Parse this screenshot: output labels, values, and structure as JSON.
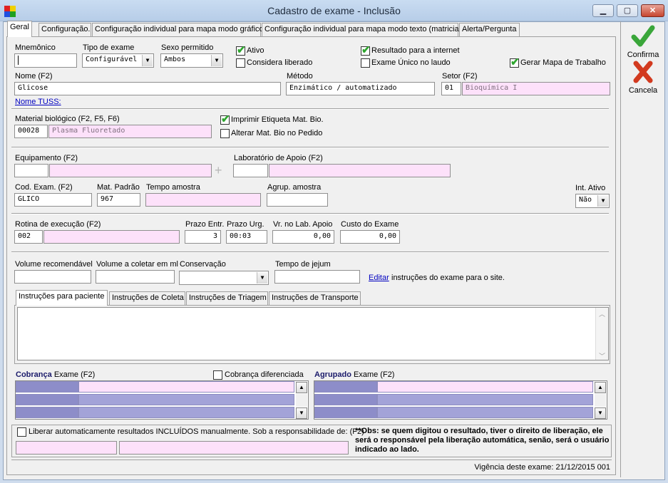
{
  "window": {
    "title": "Cadastro de exame - Inclusão"
  },
  "tabs": [
    "Geral",
    "Configuração.",
    "Configuração individual para mapa modo gráfico",
    "Configuração individual para mapa modo texto (matricial)",
    "Alerta/Pergunta"
  ],
  "side": {
    "confirm": "Confirma",
    "cancel": "Cancela"
  },
  "form": {
    "mnemonico_label": "Mnemônico",
    "mnemonico_value": "",
    "tipo_label": "Tipo de exame",
    "tipo_value": "Configurável",
    "sexo_label": "Sexo permitido",
    "sexo_value": "Ambos",
    "ativo": "Ativo",
    "considera": "Considera liberado",
    "resultado_internet": "Resultado para a internet",
    "exame_unico": "Exame Único no laudo",
    "gerar_mapa": "Gerar Mapa de Trabalho",
    "nome_label": "Nome (F2)",
    "nome_value": "Glicose",
    "metodo_label": "Método",
    "metodo_value": "Enzimático / automatizado",
    "setor_label": "Setor (F2)",
    "setor_code": "01",
    "setor_value": "Bioquímica I",
    "nome_tuss": "Nome TUSS:",
    "material_label": "Material biológico (F2, F5, F6)",
    "material_code": "00028",
    "material_value": "Plasma Fluoretado",
    "imprimir_etiqueta": "Imprimir Etiqueta Mat. Bio.",
    "alterar_mat": "Alterar Mat. Bio no Pedido",
    "equip_label": "Equipamento (F2)",
    "lab_apoio_label": "Laboratório de Apoio (F2)",
    "cod_exam_label": "Cod. Exam. (F2)",
    "cod_exam_value": "GLICO",
    "mat_padrao_label": "Mat. Padrão",
    "mat_padrao_value": "967",
    "tempo_amostra_label": "Tempo amostra",
    "agrup_amostra_label": "Agrup. amostra",
    "int_ativo_label": "Int. Ativo",
    "int_ativo_value": "Não",
    "rotina_label": "Rotina de execução (F2)",
    "rotina_code": "002",
    "prazo_entr_label": "Prazo Entr.",
    "prazo_entr_value": "3",
    "prazo_urg_label": "Prazo Urg.",
    "prazo_urg_value": "00:03",
    "vr_lab_label": "Vr. no Lab. Apoio",
    "vr_lab_value": "0,00",
    "custo_label": "Custo do Exame",
    "custo_value": "0,00",
    "volume_rec_label": "Volume recomendável",
    "volume_col_label": "Volume a coletar em ml",
    "conservacao_label": "Conservação",
    "jejum_label": "Tempo de jejum",
    "editar_link": "Editar",
    "editar_text": "instruções do exame para o site.",
    "inner_tabs": [
      "Instruções para paciente",
      "Instruções de Coleta",
      "Instruções de Triagem",
      "Instruções de Transporte"
    ],
    "cobranca_bold": "Cobrança",
    "cobranca_rest": "Exame (F2)",
    "cobranca_dif": "Cobrança diferenciada",
    "agrupado_bold": "Agrupado",
    "agrupado_rest": "Exame (F2)",
    "liberar_text": "Liberar automaticamente resultados INCLUÍDOS manualmente. Sob a responsabilidade de: (F2)",
    "obs_text": "**Obs: se quem digitou o resultado, tiver o direito de liberação, ele será o responsável pela liberação automática, senão, será o usuário indicado ao lado.",
    "vigencia": "Vigência deste exame: 21/12/2015 001"
  },
  "colors": {
    "confirm": "#3aa63a",
    "cancel": "#d23a1f",
    "pink": "#fde1fa",
    "grid_purple": "#8d8dc9",
    "link": "#0000c0"
  }
}
